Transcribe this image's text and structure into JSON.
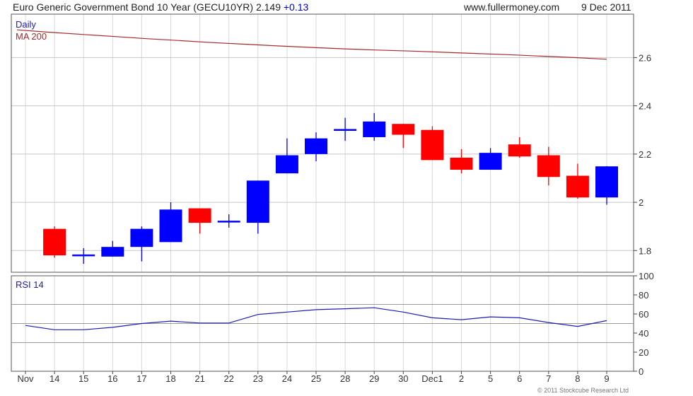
{
  "header": {
    "title": "Euro Generic Government Bond 10 Year (GECU10YR) 2.149",
    "change": "+0.13",
    "site": "www.fullermoney.com",
    "date": "9 Dec 2011"
  },
  "footer": {
    "copyright": "© 2011 Stockcube Research Ltd"
  },
  "colors": {
    "up": "#0000ff",
    "down": "#ff0000",
    "ma": "#a52a2a",
    "rsi": "#1c1cb4",
    "grid": "#d8d8d8"
  },
  "chart_data": [
    {
      "type": "candlestick",
      "title": "Daily",
      "indicator_label": "MA 200",
      "x_labels": [
        "Nov",
        "14",
        "15",
        "16",
        "17",
        "18",
        "21",
        "22",
        "23",
        "24",
        "25",
        "28",
        "29",
        "30",
        "Dec1",
        "2",
        "5",
        "6",
        "7",
        "8",
        "9"
      ],
      "candles": [
        {
          "date": "14",
          "open": 1.89,
          "high": 1.9,
          "low": 1.77,
          "close": 1.78
        },
        {
          "date": "15",
          "open": 1.78,
          "high": 1.81,
          "low": 1.745,
          "close": 1.78
        },
        {
          "date": "16",
          "open": 1.775,
          "high": 1.84,
          "low": 1.775,
          "close": 1.815
        },
        {
          "date": "17",
          "open": 1.815,
          "high": 1.9,
          "low": 1.755,
          "close": 1.89
        },
        {
          "date": "18",
          "open": 1.835,
          "high": 2.0,
          "low": 1.835,
          "close": 1.97
        },
        {
          "date": "21",
          "open": 1.975,
          "high": 1.975,
          "low": 1.87,
          "close": 1.915
        },
        {
          "date": "22",
          "open": 1.92,
          "high": 1.95,
          "low": 1.895,
          "close": 1.92
        },
        {
          "date": "23",
          "open": 1.915,
          "high": 2.09,
          "low": 1.87,
          "close": 2.09
        },
        {
          "date": "24",
          "open": 2.12,
          "high": 2.265,
          "low": 2.12,
          "close": 2.195
        },
        {
          "date": "25",
          "open": 2.2,
          "high": 2.29,
          "low": 2.17,
          "close": 2.265
        },
        {
          "date": "28",
          "open": 2.3,
          "high": 2.35,
          "low": 2.255,
          "close": 2.3
        },
        {
          "date": "29",
          "open": 2.27,
          "high": 2.37,
          "low": 2.255,
          "close": 2.335
        },
        {
          "date": "30",
          "open": 2.325,
          "high": 2.325,
          "low": 2.225,
          "close": 2.28
        },
        {
          "date": "Dec1",
          "open": 2.3,
          "high": 2.315,
          "low": 2.175,
          "close": 2.175
        },
        {
          "date": "2",
          "open": 2.185,
          "high": 2.22,
          "low": 2.12,
          "close": 2.135
        },
        {
          "date": "5",
          "open": 2.135,
          "high": 2.225,
          "low": 2.135,
          "close": 2.205
        },
        {
          "date": "6",
          "open": 2.24,
          "high": 2.27,
          "low": 2.185,
          "close": 2.19
        },
        {
          "date": "7",
          "open": 2.195,
          "high": 2.23,
          "low": 2.07,
          "close": 2.105
        },
        {
          "date": "8",
          "open": 2.11,
          "high": 2.16,
          "low": 2.015,
          "close": 2.02
        },
        {
          "date": "9",
          "open": 2.02,
          "high": 2.15,
          "low": 1.99,
          "close": 2.149
        }
      ],
      "ma_200": [
        2.715,
        2.705,
        2.696,
        2.687,
        2.678,
        2.67,
        2.662,
        2.655,
        2.648,
        2.642,
        2.636,
        2.631,
        2.627,
        2.622,
        2.617,
        2.612,
        2.606,
        2.6,
        2.593
      ],
      "y_ticks": [
        1.8,
        2,
        2.2,
        2.4,
        2.6
      ],
      "ylim": [
        1.71,
        2.78
      ],
      "grid": true
    },
    {
      "type": "line",
      "title": "RSI 14",
      "values": [
        48,
        43.5,
        43.5,
        46,
        50,
        52.5,
        50.5,
        50.5,
        59.5,
        62,
        64.5,
        65.5,
        66.5,
        62,
        56,
        54,
        57,
        56,
        51,
        47,
        53
      ],
      "y_ticks": [
        0,
        20,
        40,
        60,
        80,
        100
      ],
      "reference_lines": [
        30,
        50,
        70
      ],
      "ylim": [
        0,
        100
      ],
      "grid": true
    }
  ]
}
